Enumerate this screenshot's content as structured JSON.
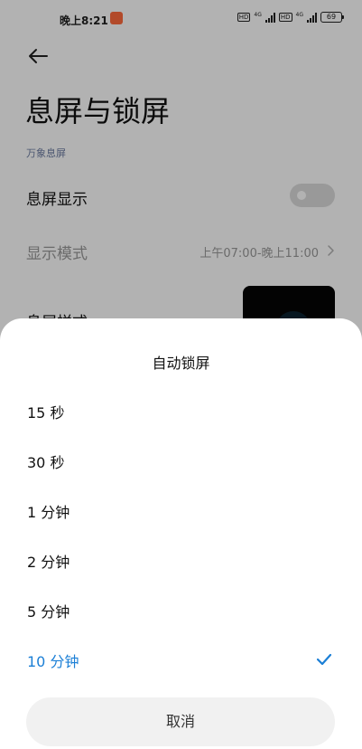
{
  "status_bar": {
    "time": "晚上8:21",
    "network_hd_1": "HD",
    "network_gen_1": "4G",
    "network_hd_2": "HD",
    "network_gen_2": "4G",
    "battery": "69"
  },
  "page": {
    "title": "息屏与锁屏",
    "section_label": "万象息屏",
    "aod_label": "息屏显示",
    "aod_enabled": false,
    "display_mode_label": "显示模式",
    "display_mode_value": "上午07:00-晚上11:00",
    "style_label": "息屏样式"
  },
  "sheet": {
    "title": "自动锁屏",
    "options": [
      {
        "label": "15 秒",
        "selected": false
      },
      {
        "label": "30 秒",
        "selected": false
      },
      {
        "label": "1 分钟",
        "selected": false
      },
      {
        "label": "2 分钟",
        "selected": false
      },
      {
        "label": "5 分钟",
        "selected": false
      },
      {
        "label": "10 分钟",
        "selected": true
      }
    ],
    "cancel_label": "取消"
  },
  "colors": {
    "accent": "#1b7fd6",
    "section_label": "#6b7aa1",
    "notification_badge": "#ff6a3d"
  },
  "icons": [
    "back-arrow-icon",
    "chevron-right-icon",
    "checkmark-icon",
    "signal-icon",
    "battery-icon"
  ]
}
